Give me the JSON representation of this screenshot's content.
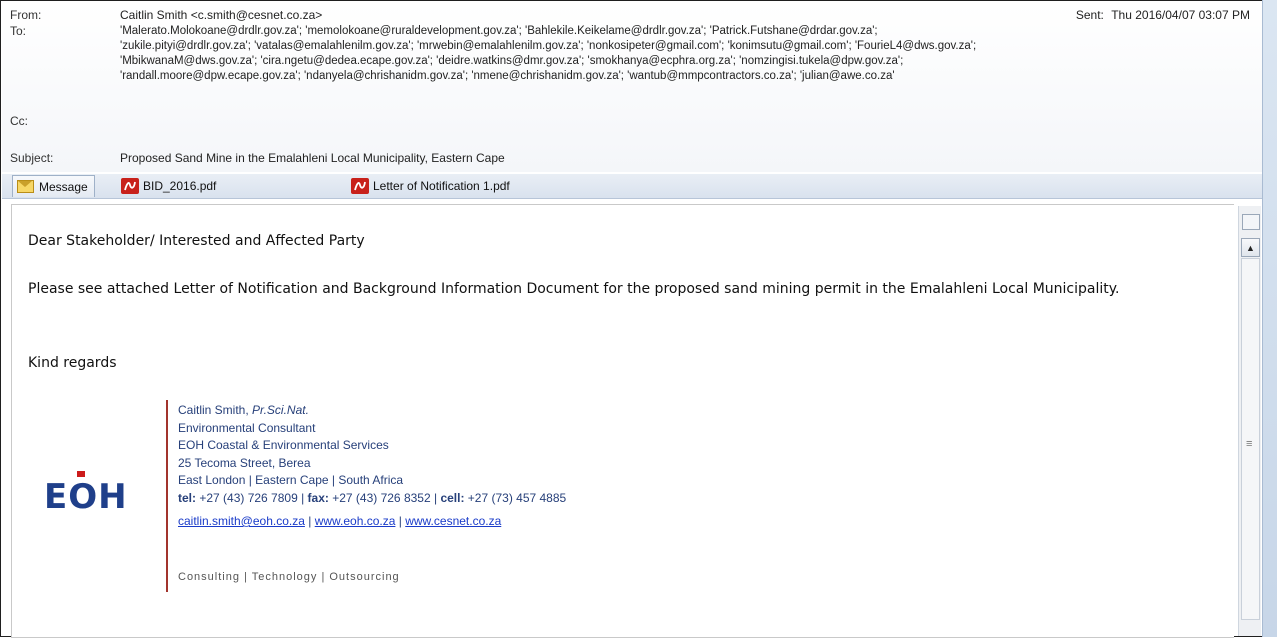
{
  "header": {
    "from_label": "From:",
    "from_value": "Caitlin Smith <c.smith@cesnet.co.za>",
    "sent_label": "Sent:",
    "sent_value": "Thu 2016/04/07 03:07 PM",
    "to_label": "To:",
    "to_lines": [
      "'Malerato.Molokoane@drdlr.gov.za'; 'memolokoane@ruraldevelopment.gov.za'; 'Bahlekile.Keikelame@drdlr.gov.za'; 'Patrick.Futshane@drdar.gov.za';",
      "'zukile.pityi@drdlr.gov.za'; 'vatalas@emalahlenilm.gov.za'; 'mrwebin@emalahlenilm.gov.za'; 'nonkosipeter@gmail.com'; 'konimsutu@gmail.com'; 'FourieL4@dws.gov.za';",
      "'MbikwanaM@dws.gov.za'; 'cira.ngetu@dedea.ecape.gov.za'; 'deidre.watkins@dmr.gov.za'; 'smokhanya@ecphra.org.za'; 'nomzingisi.tukela@dpw.gov.za';",
      "'randall.moore@dpw.ecape.gov.za'; 'ndanyela@chrishanidm.gov.za'; 'nmene@chrishanidm.gov.za'; 'wantub@mmpcontractors.co.za'; 'julian@awe.co.za'"
    ],
    "cc_label": "Cc:",
    "subject_label": "Subject:",
    "subject_value": "Proposed Sand Mine in the Emalahleni Local Municipality, Eastern Cape"
  },
  "tabs": {
    "message": "Message",
    "attachment1": "BID_2016.pdf",
    "attachment2": "Letter of Notification 1.pdf"
  },
  "body": {
    "greeting": "Dear Stakeholder/ Interested and Affected Party",
    "paragraph": "Please see attached Letter of Notification and Background Information Document for the proposed sand mining permit  in the Emalahleni Local Municipality.",
    "closing": "Kind regards"
  },
  "signature": {
    "logo": "EOH",
    "name": "Caitlin Smith, ",
    "title_suffix": "Pr.Sci.Nat.",
    "role": "Environmental Consultant",
    "company": "EOH Coastal & Environmental Services",
    "street": "25 Tecoma Street, Berea",
    "city": "East London  | Eastern Cape  |  South Africa",
    "tel_label": "tel:",
    "tel": " +27 (43) 726 7809 | ",
    "fax_label": "fax:",
    "fax": " +27 (43) 726 8352 | ",
    "cell_label": "cell:",
    "cell": " +27 (73) 457 4885",
    "email": "caitlin.smith@eoh.co.za",
    "sep1": " | ",
    "web1": "www.eoh.co.za",
    "sep2": "   |  ",
    "web2": "www.cesnet.co.za",
    "tagline": "Consulting | Technology | Outsourcing"
  },
  "colors": {
    "accent_blue": "#1f3f8a",
    "signature_bar": "#a2342d",
    "link": "#1a3bc9"
  }
}
